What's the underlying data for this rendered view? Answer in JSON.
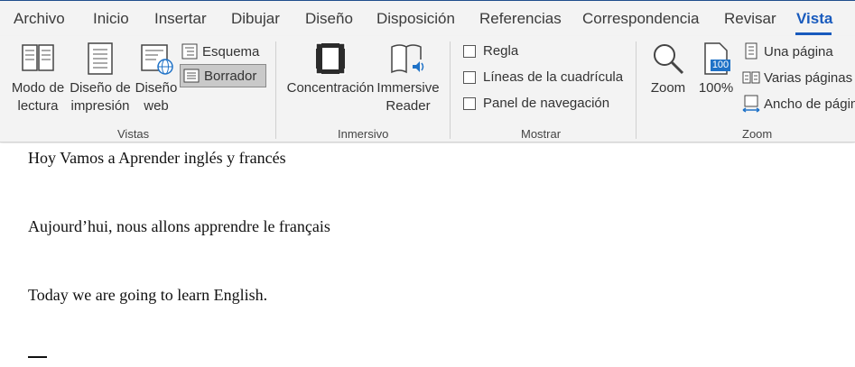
{
  "tabs": [
    {
      "label": "Archivo"
    },
    {
      "label": "Inicio"
    },
    {
      "label": "Insertar"
    },
    {
      "label": "Dibujar"
    },
    {
      "label": "Diseño"
    },
    {
      "label": "Disposición"
    },
    {
      "label": "Referencias"
    },
    {
      "label": "Correspondencia"
    },
    {
      "label": "Revisar"
    },
    {
      "label": "Vista"
    }
  ],
  "active_tab": "Vista",
  "ribbon": {
    "vistas": {
      "label": "Vistas",
      "reading_mode": {
        "line1": "Modo de",
        "line2": "lectura"
      },
      "print_layout": {
        "line1": "Diseño de",
        "line2": "impresión"
      },
      "web_layout": {
        "line1": "Diseño",
        "line2": "web"
      },
      "outline": "Esquema",
      "draft": "Borrador"
    },
    "inmersivo": {
      "label": "Inmersivo",
      "focus": "Concentración",
      "immersive_reader": {
        "line1": "Immersive",
        "line2": "Reader"
      }
    },
    "mostrar": {
      "label": "Mostrar",
      "ruler": "Regla",
      "gridlines": "Líneas de la cuadrícula",
      "nav_pane": "Panel de navegación"
    },
    "zoom": {
      "label": "Zoom",
      "zoom_btn": "Zoom",
      "hundred_badge": "100",
      "hundred_btn": "100%",
      "one_page": "Una página",
      "multiple_pages": "Varias páginas",
      "page_width": "Ancho de págin"
    }
  },
  "document": {
    "paragraphs": [
      "Hoy Vamos a Aprender inglés y francés",
      "Aujourd’hui, nous allons apprendre le français",
      "Today we are going to learn English."
    ]
  },
  "colors": {
    "accent": "#185abd",
    "ribbon_bg": "#f3f3f3"
  }
}
